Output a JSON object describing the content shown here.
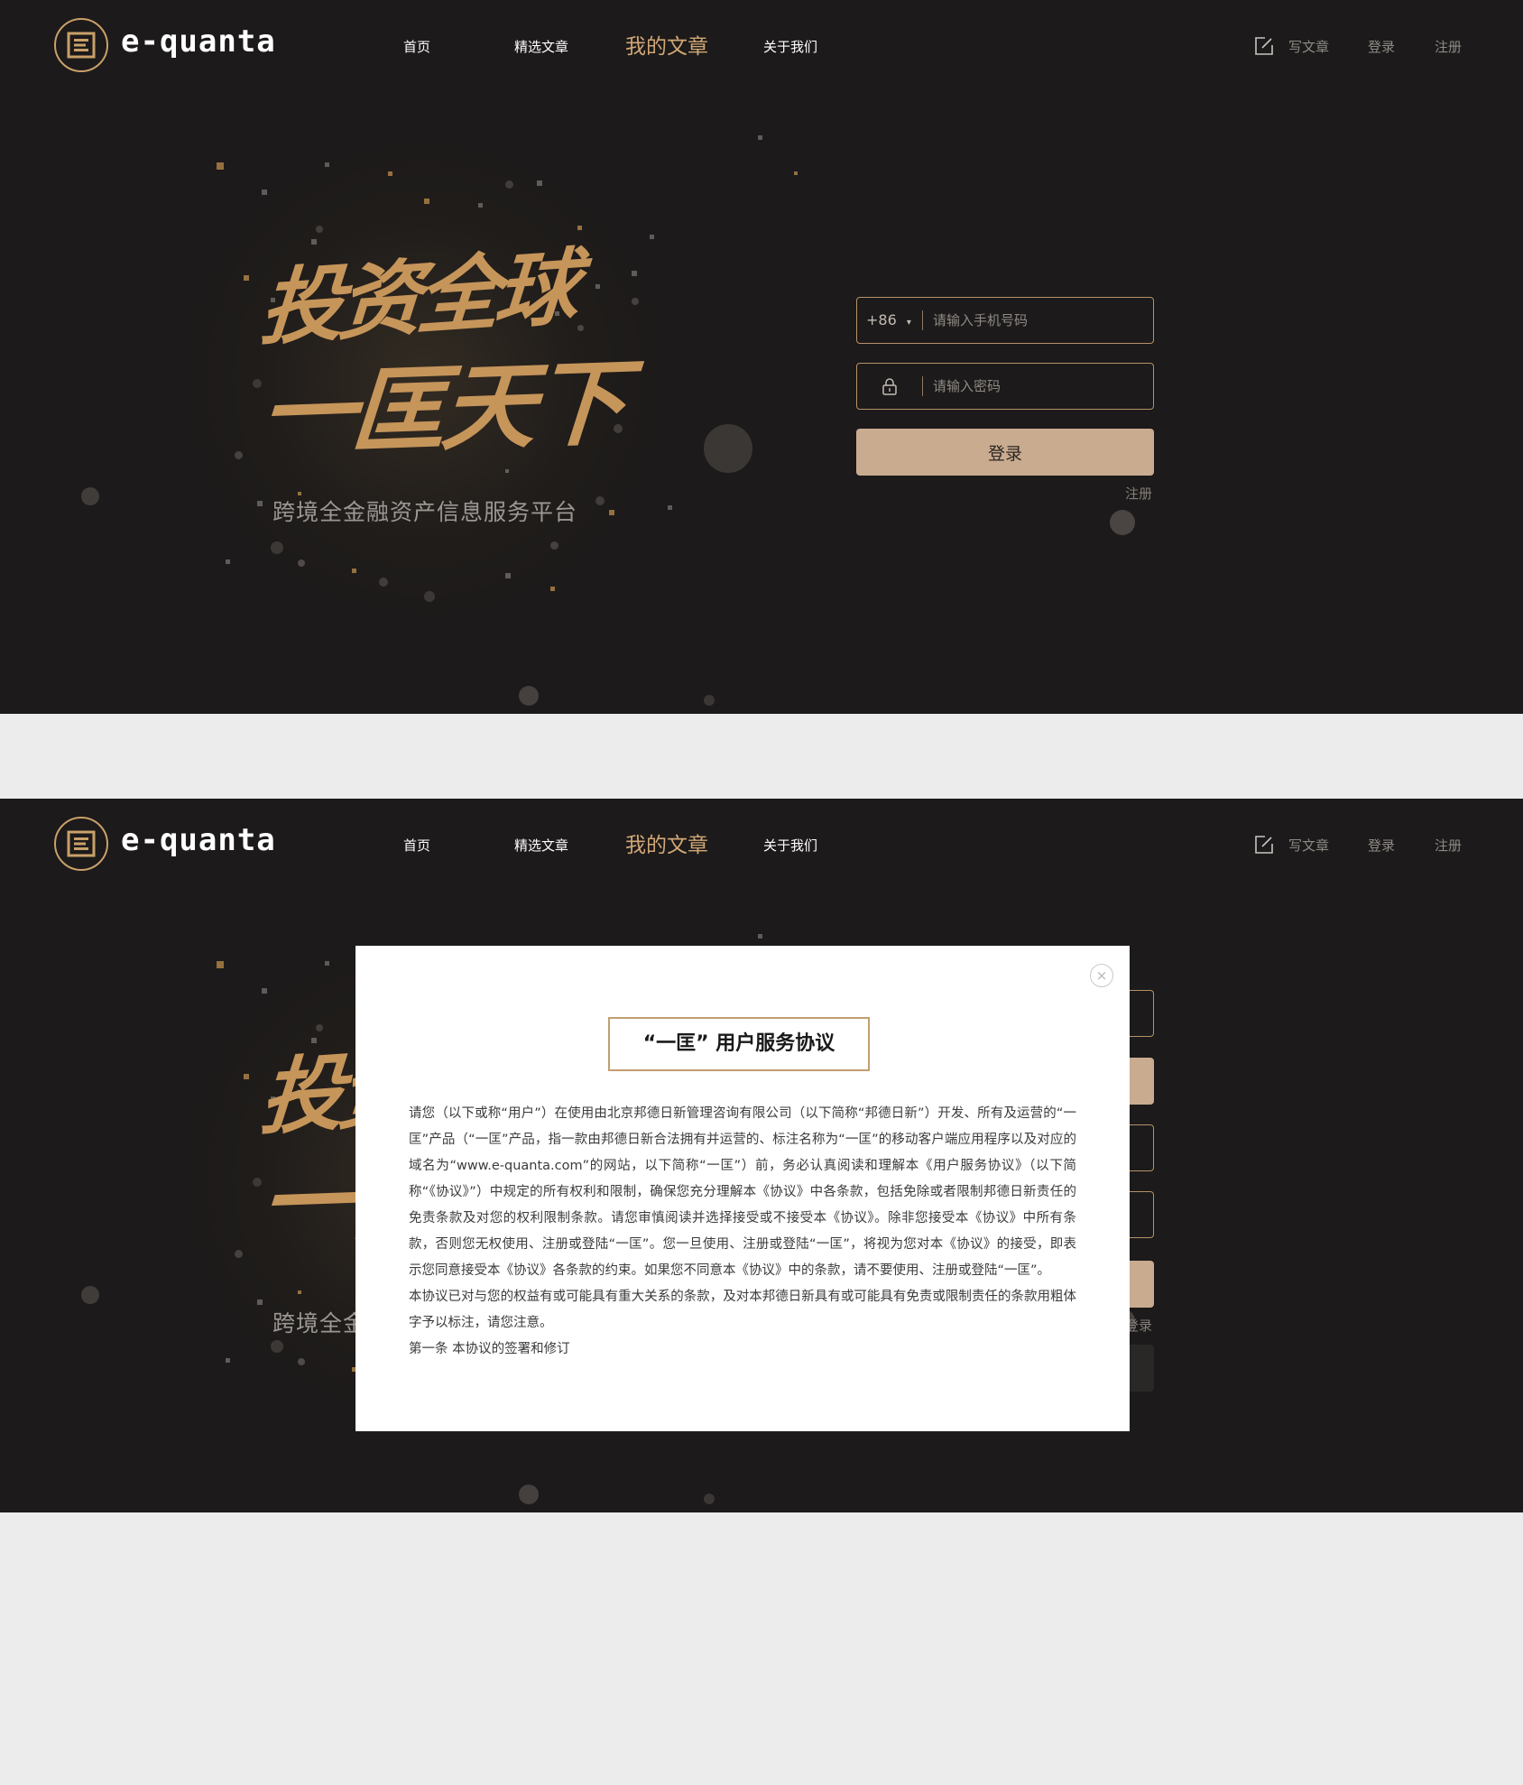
{
  "brand": {
    "name": "e-quanta",
    "logo_glyph": "匡"
  },
  "nav": {
    "items": [
      {
        "label": "首页",
        "active": false
      },
      {
        "label": "精选文章",
        "active": false
      },
      {
        "label": "我的文章",
        "active": true
      },
      {
        "label": "关于我们",
        "active": false
      }
    ]
  },
  "header_actions": {
    "write_label": "写文章",
    "write_icon": "edit-icon",
    "login_label": "登录",
    "register_label": "注册"
  },
  "hero": {
    "calligraphy_line1": "投资全球",
    "calligraphy_line2": "一匡天下",
    "subtitle": "跨境全金融资产信息服务平台"
  },
  "login_form": {
    "country_code": "+86",
    "country_code_caret": "▾",
    "phone_placeholder": "请输入手机号码",
    "password_placeholder": "请输入密码",
    "password_icon": "lock-icon",
    "submit_label": "登录",
    "register_link": "注册"
  },
  "agreement_modal": {
    "title": "“一匡” 用户服务协议",
    "close_glyph": "×",
    "paragraphs": [
      "请您（以下或称“用户”）在使用由北京邦德日新管理咨询有限公司（以下简称“邦德日新”）开发、所有及运营的“一匡”产品（“一匡”产品，指一款由邦德日新合法拥有并运营的、标注名称为“一匡”的移动客户端应用程序以及对应的域名为“www.e-quanta.com”的网站，以下简称“一匡”）前，务必认真阅读和理解本《用户服务协议》（以下简称“《协议》”）中规定的所有权利和限制，确保您充分理解本《协议》中各条款，包括免除或者限制邦德日新责任的免责条款及对您的权利限制条款。请您审慎阅读并选择接受或不接受本《协议》。除非您接受本《协议》中所有条款，否则您无权使用、注册或登陆“一匡”。您一旦使用、注册或登陆“一匡”，将视为您对本《协议》的接受，即表示您同意接受本《协议》各条款的约束。如果您不同意本《协议》中的条款，请不要使用、注册或登陆“一匡”。",
      "本协议已对与您的权益有或可能具有重大关系的条款，及对本邦德日新具有或可能具有免责或限制责任的条款用粗体字予以标注，请您注意。",
      "第一条 本协议的签署和修订"
    ]
  },
  "colors": {
    "background": "#1c1a1a",
    "accent_gold": "#c9a06a",
    "button": "#c9ab90",
    "page_gap": "#ececec"
  }
}
